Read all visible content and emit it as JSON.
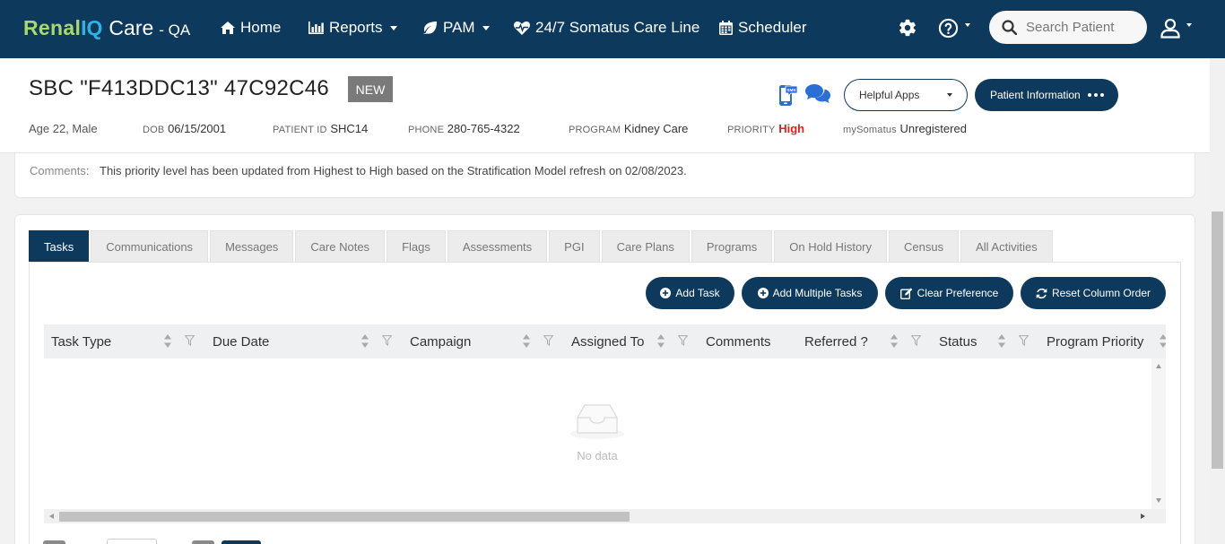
{
  "brand": {
    "part1": "Renal",
    "part2": "IQ",
    "part3": "Care",
    "env": "- QA"
  },
  "nav": {
    "home": "Home",
    "reports": "Reports",
    "pam": "PAM",
    "careline": "24/7 Somatus Care Line",
    "scheduler": "Scheduler"
  },
  "search": {
    "placeholder": "Search Patient"
  },
  "patient": {
    "name": "SBC \"F413DDC13\" 47C92C46",
    "badge": "NEW",
    "age_gender": "Age 22, Male",
    "dob_label": "DOB",
    "dob": "06/15/2001",
    "pid_label": "PATIENT ID",
    "pid": "SHC14",
    "phone_label": "PHONE",
    "phone": "280-765-4322",
    "program_label": "PROGRAM",
    "program": "Kidney Care",
    "priority_label": "PRIORITY",
    "priority": "High",
    "mysomatus_label": "mySomatus",
    "mysomatus": "Unregistered",
    "priority_color": "#e02020"
  },
  "header_buttons": {
    "helpful_apps": "Helpful Apps",
    "patient_info": "Patient Information",
    "sms_badge": "SMS"
  },
  "comments": {
    "label": "Comments:",
    "text": "This priority level has been updated from Highest to High based on the Stratification Model refresh on 02/08/2023."
  },
  "tabs": [
    {
      "label": "Tasks",
      "active": true
    },
    {
      "label": "Communications"
    },
    {
      "label": "Messages"
    },
    {
      "label": "Care Notes"
    },
    {
      "label": "Flags"
    },
    {
      "label": "Assessments"
    },
    {
      "label": "PGI"
    },
    {
      "label": "Care Plans"
    },
    {
      "label": "Programs"
    },
    {
      "label": "On Hold History"
    },
    {
      "label": "Census"
    },
    {
      "label": "All Activities"
    }
  ],
  "actions": {
    "add_task": "Add Task",
    "add_multiple": "Add Multiple Tasks",
    "clear_pref": "Clear Preference",
    "reset_order": "Reset Column Order"
  },
  "grid": {
    "columns": [
      "Task Type",
      "Due Date",
      "Campaign",
      "Assigned To",
      "Comments",
      "Referred ?",
      "Status",
      "Program Priority"
    ],
    "empty_text": "No data"
  },
  "colors": {
    "primary": "#0d3a5c",
    "brand_green": "#a9d86b",
    "brand_blue": "#2db2e3"
  },
  "icons": [
    "home-icon",
    "chart-icon",
    "leaf-icon",
    "heartbeat-icon",
    "calendar-icon",
    "gear-icon",
    "question-icon",
    "search-icon",
    "user-icon",
    "sms-icon",
    "chat-icon",
    "plus-circle-icon",
    "edit-icon",
    "refresh-icon",
    "sort-icon",
    "filter-icon",
    "empty-inbox-icon"
  ]
}
